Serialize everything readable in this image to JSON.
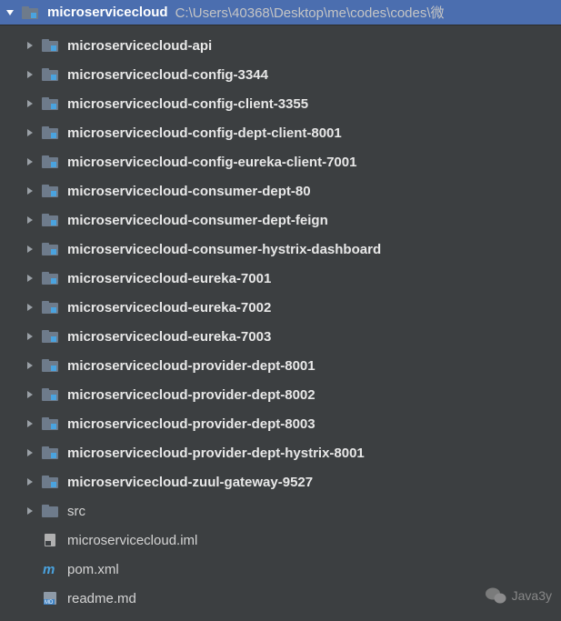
{
  "root": {
    "name": "microservicecloud",
    "path": "C:\\Users\\40368\\Desktop\\me\\codes\\codes\\微"
  },
  "nodes": [
    {
      "label": "microservicecloud-api",
      "type": "module",
      "expandable": true,
      "bold": true
    },
    {
      "label": "microservicecloud-config-3344",
      "type": "module",
      "expandable": true,
      "bold": true
    },
    {
      "label": "microservicecloud-config-client-3355",
      "type": "module",
      "expandable": true,
      "bold": true
    },
    {
      "label": "microservicecloud-config-dept-client-8001",
      "type": "module",
      "expandable": true,
      "bold": true
    },
    {
      "label": "microservicecloud-config-eureka-client-7001",
      "type": "module",
      "expandable": true,
      "bold": true
    },
    {
      "label": "microservicecloud-consumer-dept-80",
      "type": "module",
      "expandable": true,
      "bold": true
    },
    {
      "label": "microservicecloud-consumer-dept-feign",
      "type": "module",
      "expandable": true,
      "bold": true
    },
    {
      "label": "microservicecloud-consumer-hystrix-dashboard",
      "type": "module",
      "expandable": true,
      "bold": true
    },
    {
      "label": "microservicecloud-eureka-7001",
      "type": "module",
      "expandable": true,
      "bold": true
    },
    {
      "label": "microservicecloud-eureka-7002",
      "type": "module",
      "expandable": true,
      "bold": true
    },
    {
      "label": "microservicecloud-eureka-7003",
      "type": "module",
      "expandable": true,
      "bold": true
    },
    {
      "label": "microservicecloud-provider-dept-8001",
      "type": "module",
      "expandable": true,
      "bold": true
    },
    {
      "label": "microservicecloud-provider-dept-8002",
      "type": "module",
      "expandable": true,
      "bold": true
    },
    {
      "label": "microservicecloud-provider-dept-8003",
      "type": "module",
      "expandable": true,
      "bold": true
    },
    {
      "label": "microservicecloud-provider-dept-hystrix-8001",
      "type": "module",
      "expandable": true,
      "bold": true
    },
    {
      "label": "microservicecloud-zuul-gateway-9527",
      "type": "module",
      "expandable": true,
      "bold": true
    },
    {
      "label": "src",
      "type": "folder",
      "expandable": true,
      "bold": false
    },
    {
      "label": "microservicecloud.iml",
      "type": "iml",
      "expandable": false,
      "bold": false
    },
    {
      "label": "pom.xml",
      "type": "maven",
      "expandable": false,
      "bold": false
    },
    {
      "label": "readme.md",
      "type": "md",
      "expandable": false,
      "bold": false
    }
  ],
  "watermark": "Java3y"
}
